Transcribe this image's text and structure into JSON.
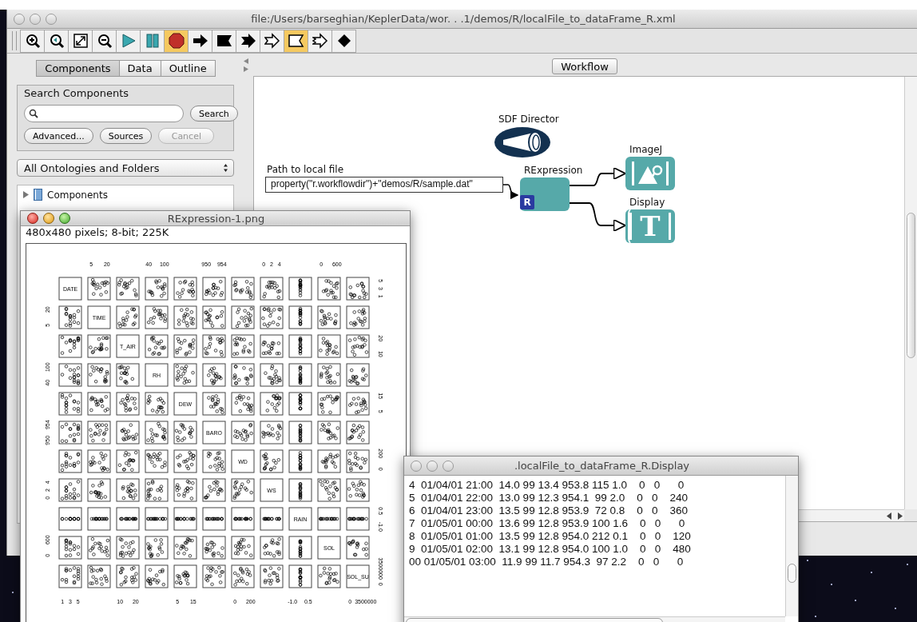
{
  "main_window": {
    "title": "file:/Users/barseghian/KeplerData/wor. . .1/demos/R/localFile_to_dataFrame_R.xml"
  },
  "toolbar": [
    {
      "kind": "zoom-in",
      "selected": false
    },
    {
      "kind": "zoom-reset",
      "selected": false
    },
    {
      "kind": "zoom-fit",
      "selected": false
    },
    {
      "kind": "zoom-out",
      "selected": false
    },
    {
      "kind": "run",
      "selected": false
    },
    {
      "kind": "pause",
      "selected": false
    },
    {
      "kind": "stop",
      "selected": true
    },
    {
      "kind": "arrow",
      "selected": false
    },
    {
      "kind": "flag",
      "selected": false
    },
    {
      "kind": "notched-arrow",
      "selected": false
    },
    {
      "kind": "outline-arrow",
      "selected": false
    },
    {
      "kind": "outline-flag",
      "selected": true
    },
    {
      "kind": "outline-notched",
      "selected": false
    },
    {
      "kind": "diamond",
      "selected": false
    }
  ],
  "library_tabs": [
    {
      "label": "Components",
      "selected": true
    },
    {
      "label": "Data",
      "selected": false
    },
    {
      "label": "Outline",
      "selected": false
    }
  ],
  "search": {
    "legend": "Search Components",
    "buttons": [
      {
        "label": "Search",
        "disabled": false
      },
      {
        "label": "Advanced...",
        "disabled": false
      },
      {
        "label": "Sources",
        "disabled": false
      },
      {
        "label": "Cancel",
        "disabled": true
      }
    ]
  },
  "ontology_select": {
    "value": "All Ontologies and Folders"
  },
  "tree": [
    {
      "label": "Components",
      "expanded": false
    }
  ],
  "workflow_tab": {
    "label": "Workflow"
  },
  "canvas": {
    "director": {
      "label": "SDF Director"
    },
    "parameter": {
      "label": "Path to local file",
      "value": "property(\"r.workflowdir\")+\"demos/R/sample.dat\""
    },
    "actors": [
      {
        "kind": "rexpression",
        "label": "RExpression",
        "badge": "R"
      },
      {
        "kind": "imagej",
        "label": "ImageJ"
      },
      {
        "kind": "display",
        "label": "Display",
        "glyph": "T"
      }
    ]
  },
  "image_window": {
    "title": "RExpression-1.png",
    "info": "480x480 pixels; 8-bit; 225K",
    "plot": {
      "variables": [
        {
          "name": "DATE",
          "axis_ticks": [
            "1",
            "3",
            "5"
          ],
          "side_ticks": [
            "1",
            "3",
            "5"
          ]
        },
        {
          "name": "TIME",
          "axis_ticks": [
            "5",
            "20"
          ],
          "side_ticks": [
            "5",
            "20"
          ]
        },
        {
          "name": "T_AIR",
          "axis_ticks": [
            "10",
            "20"
          ],
          "side_ticks": [
            "10",
            "20"
          ]
        },
        {
          "name": "RH",
          "axis_ticks": [
            "40",
            "100"
          ],
          "side_ticks": [
            "40",
            "100"
          ]
        },
        {
          "name": "DEW",
          "axis_ticks": [
            "5",
            "15"
          ],
          "side_ticks": [
            "5",
            "15"
          ]
        },
        {
          "name": "BARO",
          "axis_ticks": [
            "950",
            "954"
          ],
          "side_ticks": [
            "950",
            "954"
          ]
        },
        {
          "name": "WD",
          "axis_ticks": [
            "0",
            "200"
          ],
          "side_ticks": [
            "0",
            "200"
          ]
        },
        {
          "name": "WS",
          "axis_ticks": [
            "0",
            "2",
            "4"
          ],
          "side_ticks": [
            "0",
            "2",
            "4"
          ]
        },
        {
          "name": "RAIN",
          "axis_ticks": [
            "-1.0",
            "0.5"
          ],
          "side_ticks": [
            "-1.0",
            "0.5"
          ]
        },
        {
          "name": "SOL",
          "axis_ticks": [
            "0",
            "600"
          ],
          "side_ticks": [
            "0",
            "600"
          ]
        },
        {
          "name": "SOL_SU",
          "axis_ticks": [
            "0",
            "3500000"
          ],
          "side_ticks": [
            "0",
            "3500000"
          ]
        }
      ]
    }
  },
  "display_window": {
    "title": ".localFile_to_dataFrame_R.Display",
    "lines": [
      "4  01/04/01 21:00  14.0 99 13.4 953.8 115 1.0    0   0      0",
      "5  01/04/01 22:00  13.0 99 12.3 954.1  99 2.0    0   0    240",
      "6  01/04/01 23:00  13.5 99 12.8 953.9  72 0.8    0   0    360",
      "7  01/05/01 00:00  13.6 99 12.8 953.9 100 1.6    0   0      0",
      "8  01/05/01 01:00  13.5 99 12.8 954.0 212 0.1    0   0    120",
      "9  01/05/01 02:00  13.1 99 12.8 954.0 100 1.0    0   0    480",
      "00 01/05/01 03:00  11.9 99 11.7 954.3  97 2.2    0   0      0"
    ]
  }
}
